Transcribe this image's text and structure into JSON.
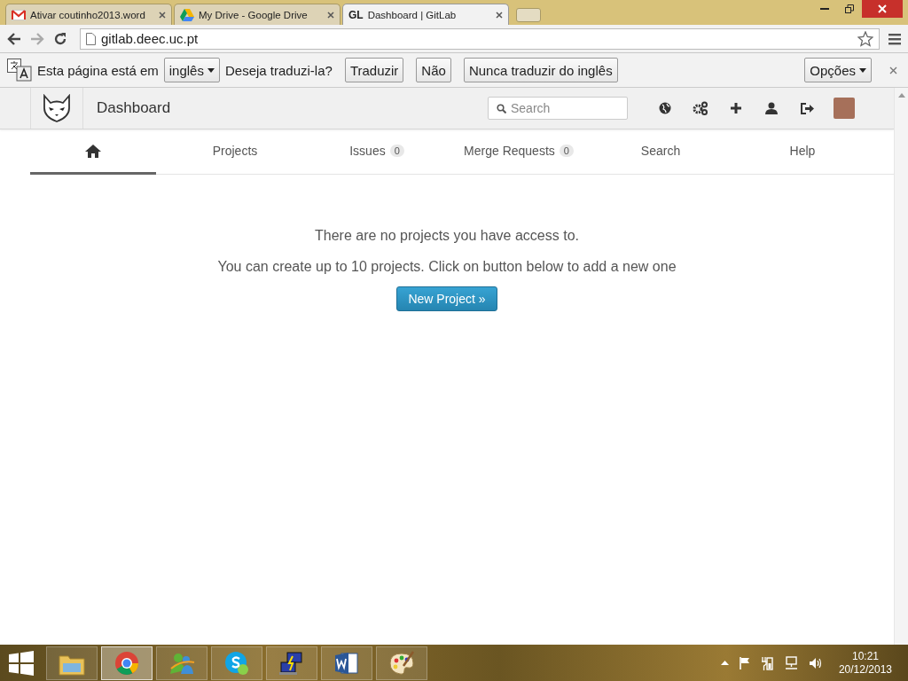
{
  "browser": {
    "tabs": [
      {
        "title": "Ativar coutinho2013.word",
        "selected": false
      },
      {
        "title": "My Drive - Google Drive",
        "selected": false
      },
      {
        "icon_text": "GL",
        "title": "Dashboard | GitLab",
        "selected": true
      }
    ],
    "address": "gitlab.deec.uc.pt"
  },
  "translate_bar": {
    "message": "Esta página está em",
    "language": "inglês",
    "question": "Deseja traduzi-la?",
    "buttons": [
      "Traduzir",
      "Não",
      "Nunca traduzir do inglês"
    ],
    "options": "Opções"
  },
  "header": {
    "title": "Dashboard",
    "search_placeholder": "Search"
  },
  "nav": [
    {
      "kind": "home",
      "selected": true
    },
    {
      "kind": "text",
      "label": "Projects",
      "selected": false
    },
    {
      "kind": "text",
      "label": "Issues",
      "count": "0",
      "selected": false
    },
    {
      "kind": "text",
      "label": "Merge Requests",
      "count": "0",
      "selected": false
    },
    {
      "kind": "text",
      "label": "Search",
      "selected": false
    },
    {
      "kind": "text",
      "label": "Help",
      "selected": false
    }
  ],
  "content": {
    "message": "There are no projects you have access to.",
    "hint": "You can create up to 10 projects. Click on button below to add a new one",
    "button": "New Project »"
  },
  "taskbar": {
    "apps": [
      {
        "kind": "explorer",
        "selected": false
      },
      {
        "kind": "chrome",
        "selected": true
      },
      {
        "kind": "messenger",
        "selected": false
      },
      {
        "kind": "skype",
        "selected": false
      },
      {
        "kind": "network",
        "selected": false
      },
      {
        "kind": "word",
        "selected": false
      },
      {
        "kind": "paint",
        "selected": false
      }
    ],
    "time": "10:21",
    "date": "20/12/2013"
  }
}
